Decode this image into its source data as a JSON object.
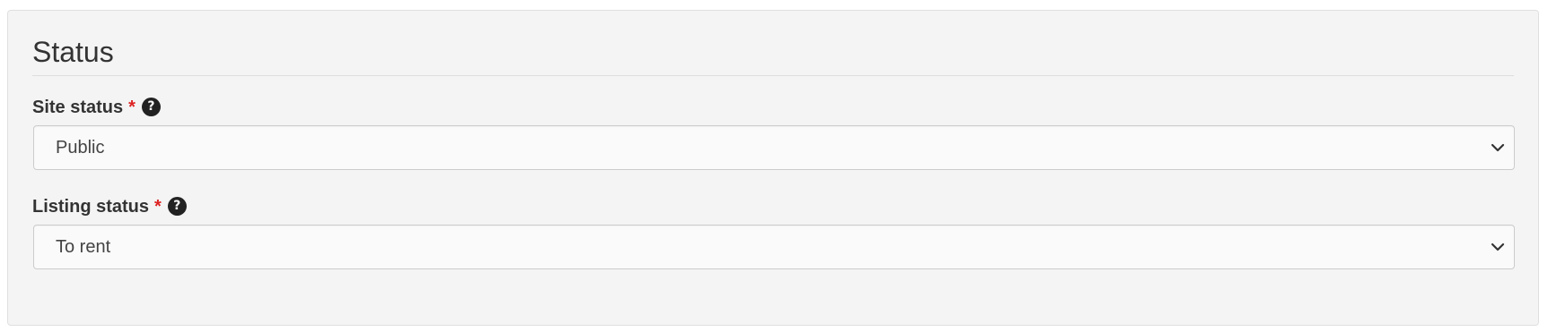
{
  "panel": {
    "title": "Status"
  },
  "fields": {
    "site_status": {
      "label": "Site status",
      "required_mark": "*",
      "help_icon": "question-circle-icon",
      "value": "Public"
    },
    "listing_status": {
      "label": "Listing status",
      "required_mark": "*",
      "help_icon": "question-circle-icon",
      "value": "To rent"
    }
  },
  "colors": {
    "panel_background": "#f4f4f4",
    "required_marker": "#dd2222",
    "help_icon_fill": "#222222"
  }
}
